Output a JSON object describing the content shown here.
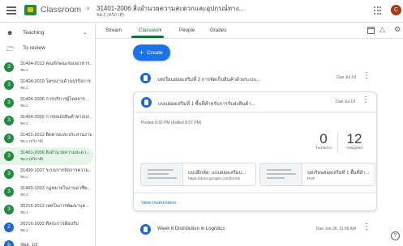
{
  "header": {
    "app_title": "Classroom",
    "separator": "›",
    "class_title": "31401-2006 สิ่งอำนวยความสะดวกและอุปกรณ์ทาง...",
    "class_section": "ชผ.2 (ทวิภาคี)",
    "avatar_letter": "C"
  },
  "sidebar": {
    "teaching_label": "Teaching",
    "to_review_label": "To review",
    "courses": [
      {
        "badge": "3",
        "badge_color": "#1e8e3e",
        "name": "31404-2012 คุณลักษณะของอาหาร...",
        "section": "ชผ.2"
      },
      {
        "badge": "3",
        "badge_color": "#1e8e3e",
        "name": "31404-2019 โครงงานด้านธุรกิจการ...",
        "section": "ชผ.2"
      },
      {
        "badge": "3",
        "badge_color": "#1e8e3e",
        "name": "31404-2006 การบริการผู้โดยสาร...",
        "section": "ชผ.2"
      },
      {
        "badge": "3",
        "badge_color": "#1e8e3e",
        "name": "31404-2002 การขนส่งสินค้าทางบก...",
        "section": "ชผ.2"
      },
      {
        "badge": "3",
        "badge_color": "#1e8e3e",
        "name": "31401-2012 ติดตามและประสานงาน...",
        "section": "ชผ.2 (ทวิภาคี)"
      },
      {
        "badge": "3",
        "badge_color": "#1e8e3e",
        "name": "31401-2006 สิ่งอำนวยความสะดว...",
        "section": "ชผ.2 (ทวิภาคี)",
        "active": true
      },
      {
        "badge": "3",
        "badge_color": "#1e8e3e",
        "name": "31400-1007 ระบบการจัดการความ...",
        "section": "ชผ.2"
      },
      {
        "badge": "3",
        "badge_color": "#1e8e3e",
        "name": "31400-1003 กฎหมายในงานอาชีพ...",
        "section": "ชผ.2"
      },
      {
        "badge": "3",
        "badge_color": "#1e8e3e",
        "name": "30216-2012 เทคโนการพัฒนาบุค...",
        "section": "ชผ.1"
      },
      {
        "badge": "2",
        "badge_color": "#1967d2",
        "name": "20216-2002 ศิลปะการต้อนรับ",
        "section": "ชผ.1"
      },
      {
        "badge": "b",
        "badge_color": "#1967d2",
        "name": "ชผส. 1/2",
        "section": ""
      }
    ]
  },
  "tabs": {
    "stream": "Stream",
    "classwork": "Classwork",
    "people": "People",
    "grades": "Grades"
  },
  "main": {
    "create_label": "Create",
    "assignments": [
      {
        "title": "บทเรียนย่อยเสริมที่ 2 การจัดเก็บสินค้าด้วยระบบ...",
        "due": "Due Jul 19"
      },
      {
        "title": "แบบย่อยเสริมที่ 1 พื้นที่สำหรับการรับส่งสินค้า...",
        "due": "Due Jul 19"
      },
      {
        "title": "Week 6 Distribution in Logistics",
        "due": "Due Jun 28, 11:59 AM"
      }
    ],
    "expanded": {
      "posted": "Posted 8:32 PM (Edited 8:57 PM)",
      "turned_in_count": "0",
      "turned_in_label": "Turned in",
      "assigned_count": "12",
      "assigned_label": "Assigned",
      "attachments": [
        {
          "title": "แบบฝึกหัด: แบบย่อยเสริมบ...",
          "sub": "https://docs.google.com/forms"
        },
        {
          "title": "บทเรียนย่อยเสริมที่ 1 พื้นที่สำ...",
          "sub": "PDF"
        }
      ],
      "view_instructions": "View instructions"
    }
  },
  "help_label": "?"
}
